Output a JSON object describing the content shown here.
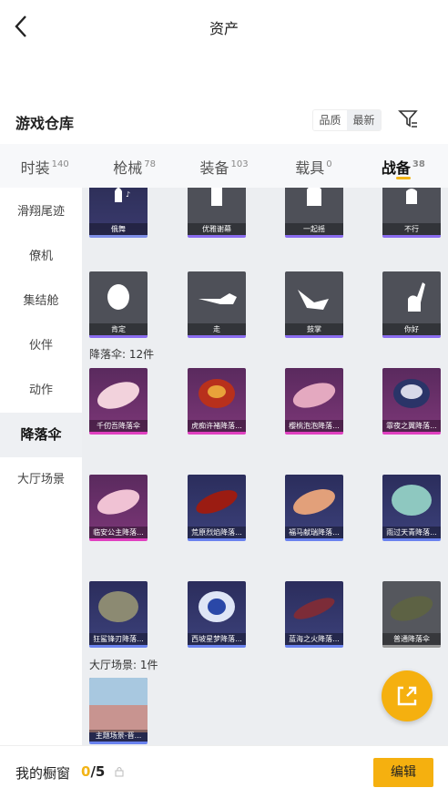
{
  "header": {
    "title": "资产"
  },
  "warehouse": {
    "title": "游戏仓库",
    "sort": [
      "品质",
      "最新"
    ]
  },
  "tabs": [
    {
      "label": "时装",
      "count": "140"
    },
    {
      "label": "枪械",
      "count": "78"
    },
    {
      "label": "装备",
      "count": "103"
    },
    {
      "label": "载具",
      "count": "0"
    },
    {
      "label": "战备",
      "count": "38"
    }
  ],
  "sidebar": [
    "滑翔尾迹",
    "僚机",
    "集结舱",
    "伙伴",
    "动作",
    "降落伞",
    "大厅场景"
  ],
  "sections": {
    "emotes_partial": [
      "俄舞",
      "优雅谢幕",
      "一起摇",
      "不行"
    ],
    "emotes": [
      "肯定",
      "走",
      "鼓掌",
      "你好"
    ],
    "parachute": {
      "title": "降落伞: 12件",
      "items": [
        "千仞吾降落伞",
        "虎痴许褚降落...",
        "樱桃泡泡降落...",
        "霏夜之翼降落...",
        "临安公主降落...",
        "荒原烈焰降落...",
        "福马献瑞降落...",
        "雨过天青降落...",
        "狂鲨锋刃降落...",
        "西坡星梦降落...",
        "蓝海之火降落...",
        "普通降落伞"
      ]
    },
    "lobby": {
      "title": "大厅场景: 1件",
      "items": [
        "主题场景-晋..."
      ]
    }
  },
  "bottom": {
    "label": "我的橱窗",
    "count_current": "0",
    "count_total": "/5",
    "edit_label": "编辑"
  },
  "colors": {
    "accent": "#f5b00f",
    "active_tab_underline": "#f2b417"
  }
}
